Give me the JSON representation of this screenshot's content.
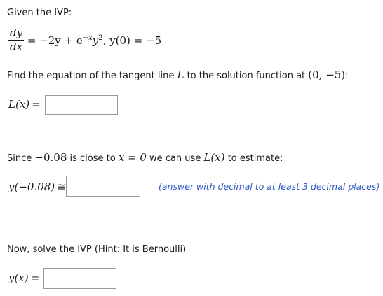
{
  "intro": "Given the IVP:",
  "ode": {
    "num": "dy",
    "den": "dx",
    "rhs": "= −2y + e",
    "exp": "−x",
    "y_power": "y",
    "y_exp": "2",
    "ic": ", y(0) = −5"
  },
  "tangent_prompt": {
    "pre": "Find the equation of the tangent line ",
    "var": "L",
    "mid": " to the solution function at ",
    "point": "(0, −5)",
    "post": ":"
  },
  "L_label": "L(x)",
  "L_rel": "=",
  "L_value": "",
  "estimate_prompt": {
    "pre": "Since ",
    "num": "−0.08",
    "mid": " is close to ",
    "eq": "x = 0",
    "mid2": " we can use ",
    "fn": "L(x)",
    "post": " to estimate:"
  },
  "y_est_label": "y(−0.08)",
  "y_est_rel": "≅",
  "y_est_value": "",
  "y_est_hint": "(answer with decimal to at least 3 decimal places)",
  "solve_prompt": "Now, solve the IVP (Hint: It is Bernoulli)",
  "y_label": "y(x)",
  "y_rel": "=",
  "y_value": ""
}
